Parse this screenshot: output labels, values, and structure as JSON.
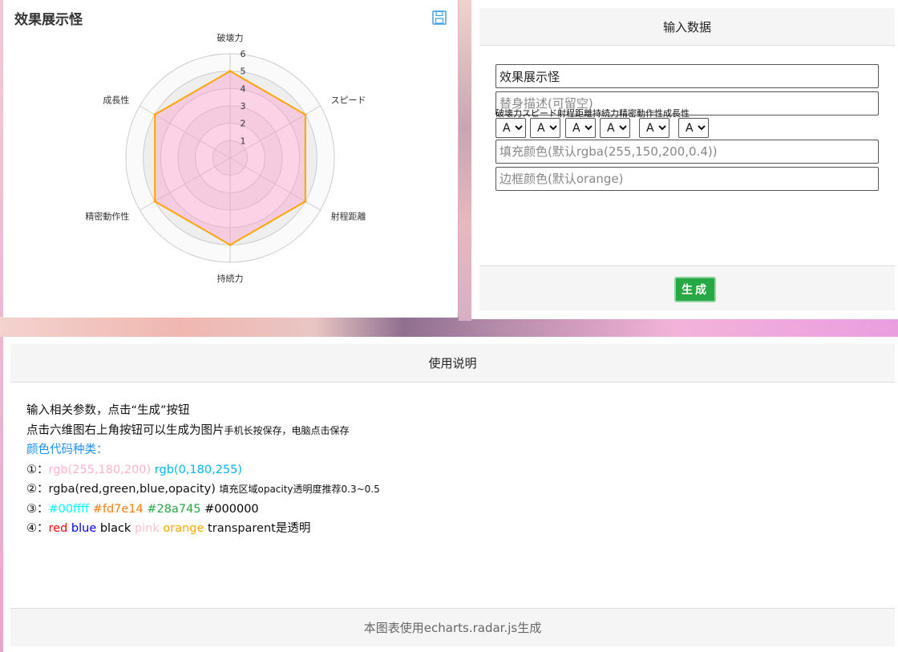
{
  "chart_panel": {
    "title": "效果展示怪",
    "save_icon": "save-icon"
  },
  "chart_data": {
    "type": "radar",
    "title": "效果展示怪",
    "indicators": [
      "破壊力",
      "スピード",
      "射程距離",
      "持続力",
      "精密動作性",
      "成長性"
    ],
    "series": [
      {
        "values": [
          5,
          5,
          5,
          5,
          5,
          5
        ]
      }
    ],
    "max": 6,
    "ticks": [
      "1",
      "2",
      "3",
      "4",
      "5",
      "6"
    ],
    "fill_color": "rgba(255,150,200,0.4)",
    "border_color": "orange"
  },
  "input_panel": {
    "header": "输入数据",
    "name_value": "效果展示怪",
    "desc_placeholder": "替身描述(可留空)",
    "stat_labels": "破壊力スピード射程距離持続力精密動作性成長性",
    "selects": [
      "A",
      "A",
      "A",
      "A",
      "A",
      "A"
    ],
    "fill_placeholder": "填充颜色(默认rgba(255,150,200,0.4))",
    "border_placeholder": "边框颜色(默认orange)",
    "generate_label": "生成"
  },
  "help_panel": {
    "header": "使用说明",
    "line1": "输入相关参数，点击“生成”按钮",
    "line2_main": "点击六维图右上角按钮可以生成为图片",
    "line2_small": "手机长按保存，电脑点击保存",
    "line3": "颜色代码种类：",
    "l4_prefix": "①：",
    "l4_a": "rgb(255,180,200)",
    "l4_b": "rgb(0,180,255)",
    "l5_prefix": "②：",
    "l5_main": "rgba(red,green,blue,opacity)",
    "l5_small": "填充区域opacity透明度推荐0.3~0.5",
    "l6_prefix": "③：",
    "l6_a": "#00ffff",
    "l6_b": "#fd7e14",
    "l6_c": "#28a745",
    "l6_d": "#000000",
    "l7_prefix": "④：",
    "l7_a": "red",
    "l7_b": "blue",
    "l7_c": "black",
    "l7_d": "pink",
    "l7_e": "orange",
    "l7_f": "transparent是透明",
    "footer": "本图表使用echarts.radar.js生成"
  },
  "colors": {
    "accent_blue": "#1e90ff",
    "success_green": "#28a745",
    "c_rgb1": "#ffb4c8",
    "c_rgb2": "#00b4ff",
    "c_cyan": "#00ffff",
    "c_orange": "#fd7e14",
    "c_green": "#28a745",
    "c_black": "#000000",
    "c_red": "#ff0000",
    "c_blue": "#0000ff",
    "c_pink": "#ffc0cb",
    "c_orange2": "#ffa500"
  }
}
